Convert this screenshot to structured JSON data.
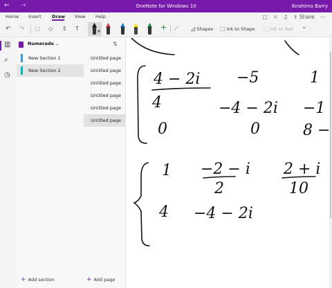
{
  "titlebar": {
    "title": "OneNote for Windows 10",
    "user": "Ibrahima Barry",
    "back_glyph": "←",
    "forward_glyph": "→"
  },
  "menu": {
    "items": [
      "Home",
      "Insert",
      "Draw",
      "View",
      "Help"
    ],
    "active": "Draw",
    "share_label": "Share"
  },
  "toolbar": {
    "undo_glyph": "↶",
    "redo_glyph": "↷",
    "shapes_label": "Shapes",
    "ink_to_shape_label": "Ink to Shape",
    "ink_to_text_label": "Ink to Text",
    "add_glyph": "+",
    "more_glyph": "⌄",
    "pens": [
      {
        "name": "pen-black-selected",
        "color": "#111111"
      },
      {
        "name": "pen-red",
        "color": "#d13438"
      },
      {
        "name": "pen-blue",
        "color": "#0078d4"
      },
      {
        "name": "highlighter-yellow",
        "color": "#ffe600"
      },
      {
        "name": "pen-green",
        "color": "#10893e"
      }
    ]
  },
  "notebook": {
    "name": "Numerade",
    "sections": [
      {
        "label": "New Section 1",
        "color": "#3a96dd"
      },
      {
        "label": "New Section 2",
        "color": "#00b7c3"
      }
    ],
    "add_section_label": "Add section"
  },
  "pages": {
    "items": [
      "Untitled page",
      "Untitled page",
      "Untitled page",
      "Untitled page",
      "Untitled page",
      "Untitled page"
    ],
    "selected_index": 5,
    "add_page_label": "Add page"
  },
  "ink": {
    "matrix1": {
      "row1": [
        "4 − 2i",
        "−5",
        "1"
      ],
      "row2": [
        "4",
        "−4 − 2i",
        "−1"
      ],
      "row3": [
        "0",
        "0",
        "8 −"
      ]
    },
    "matrix2": {
      "row1": [
        "1",
        "−2 − i",
        "2 + i"
      ],
      "row1_denominators": [
        "",
        "2",
        "10"
      ],
      "row2": [
        "4",
        "−4 − 2i"
      ]
    }
  }
}
